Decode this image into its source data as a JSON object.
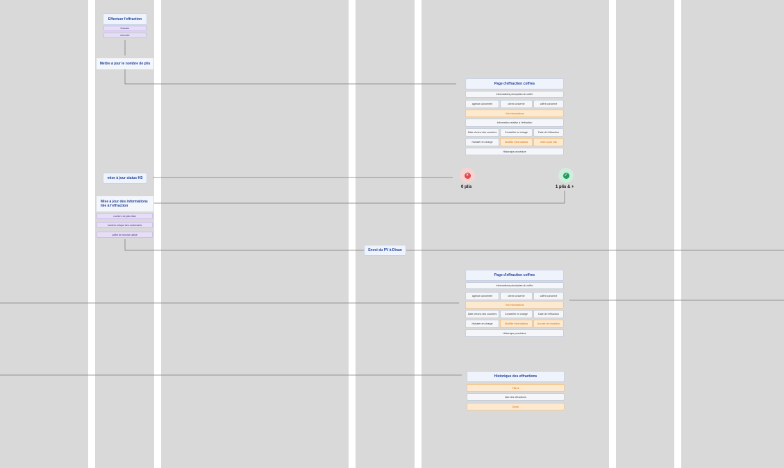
{
  "process": {
    "perform": {
      "title": "Effectuer l'effraction",
      "options": [
        "Huissier",
        "serrurier"
      ]
    },
    "update_count": "Mettre à jour le nombre de plis",
    "update_status": "mise à jour status HS",
    "update_info": {
      "title": "Mise à jour des informations liée à l'effraction",
      "items": [
        "nombre de plis étais",
        "numéro unique des contenants",
        "coffre de service utilisé"
      ]
    },
    "send_pv": "Envoi du PV à Dinan"
  },
  "outcomes": {
    "zero": "0 plis",
    "one_plus": "1 plis & +"
  },
  "page1": {
    "title": "Page d'effraction coffres",
    "section1": "Informations principales du coffre",
    "row1": [
      "agence concernée",
      "client concerné",
      "coffre concerné"
    ],
    "highlight": "Voir informations",
    "section2": "Information relative à l'effraction",
    "row2": [
      "Date chrono des courriers",
      "Conseiller en charge",
      "Date de l'effraction"
    ],
    "row3": [
      "Huissier en charge",
      "Modifier informations",
      "mise à jour plis"
    ],
    "footer": "Historique procédure"
  },
  "page2": {
    "title": "Page d'effraction coffres",
    "section1": "Informations principales du coffre",
    "row1": [
      "agence concernée",
      "client concerné",
      "coffre concerné"
    ],
    "highlight": "Voir informations",
    "row2": [
      "Date chrono des courriers",
      "Conseiller en charge",
      "Date de l'effraction"
    ],
    "row3": [
      "Huissier en charge",
      "Modifier informations",
      "Accusé de réception"
    ],
    "footer": "Historique procédure"
  },
  "history": {
    "title": "Historique des effractions",
    "items": [
      "Filtres",
      "liste des effractions",
      "Ouvrir"
    ]
  },
  "colors": {
    "lane": "#d9d9d9",
    "accent": "#1f3f99",
    "highlight": "#fde9cf",
    "sub": "#e6ddf6",
    "error": "#e5484d",
    "success": "#1f9e57"
  }
}
